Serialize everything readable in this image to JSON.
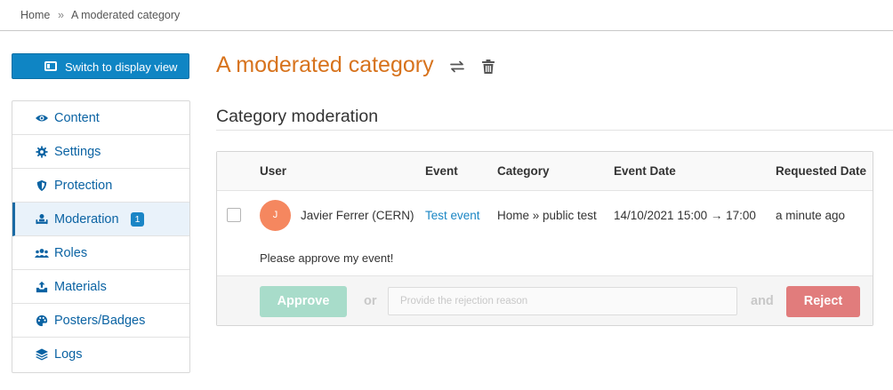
{
  "breadcrumb": {
    "home": "Home",
    "separator": "»",
    "current": "A moderated category"
  },
  "switch_button": {
    "label": "Switch to display view",
    "icon": "display-view-icon"
  },
  "sidebar": {
    "items": [
      {
        "label": "Content",
        "icon": "eye-icon"
      },
      {
        "label": "Settings",
        "icon": "gear-icon"
      },
      {
        "label": "Protection",
        "icon": "shield-icon"
      },
      {
        "label": "Moderation",
        "icon": "moderation-icon",
        "badge": "1",
        "active": true
      },
      {
        "label": "Roles",
        "icon": "users-icon"
      },
      {
        "label": "Materials",
        "icon": "inbox-upload-icon"
      },
      {
        "label": "Posters/Badges",
        "icon": "palette-icon"
      },
      {
        "label": "Logs",
        "icon": "layers-icon"
      }
    ]
  },
  "page": {
    "title": "A moderated category",
    "title_icons": [
      "move-icon",
      "trash-icon"
    ]
  },
  "section": {
    "title": "Category moderation"
  },
  "table": {
    "columns": [
      "User",
      "Event",
      "Category",
      "Event Date",
      "Requested Date"
    ],
    "rows": [
      {
        "avatar_initial": "J",
        "user": "Javier Ferrer (CERN)",
        "event": "Test event",
        "category": "Home » public test",
        "event_date": "14/10/2021 15:00 → 17:00",
        "requested": "a minute ago",
        "comment": "Please approve my event!"
      }
    ]
  },
  "actions": {
    "approve": "Approve",
    "or": "or",
    "reason_placeholder": "Provide the rejection reason",
    "and": "and",
    "reject": "Reject"
  },
  "colors": {
    "accent": "#0f85c4",
    "title": "#d7731d",
    "link": "#1a86c4",
    "approve": "#a8dcca",
    "reject": "#e17c7c",
    "avatar": "#f5875f"
  }
}
